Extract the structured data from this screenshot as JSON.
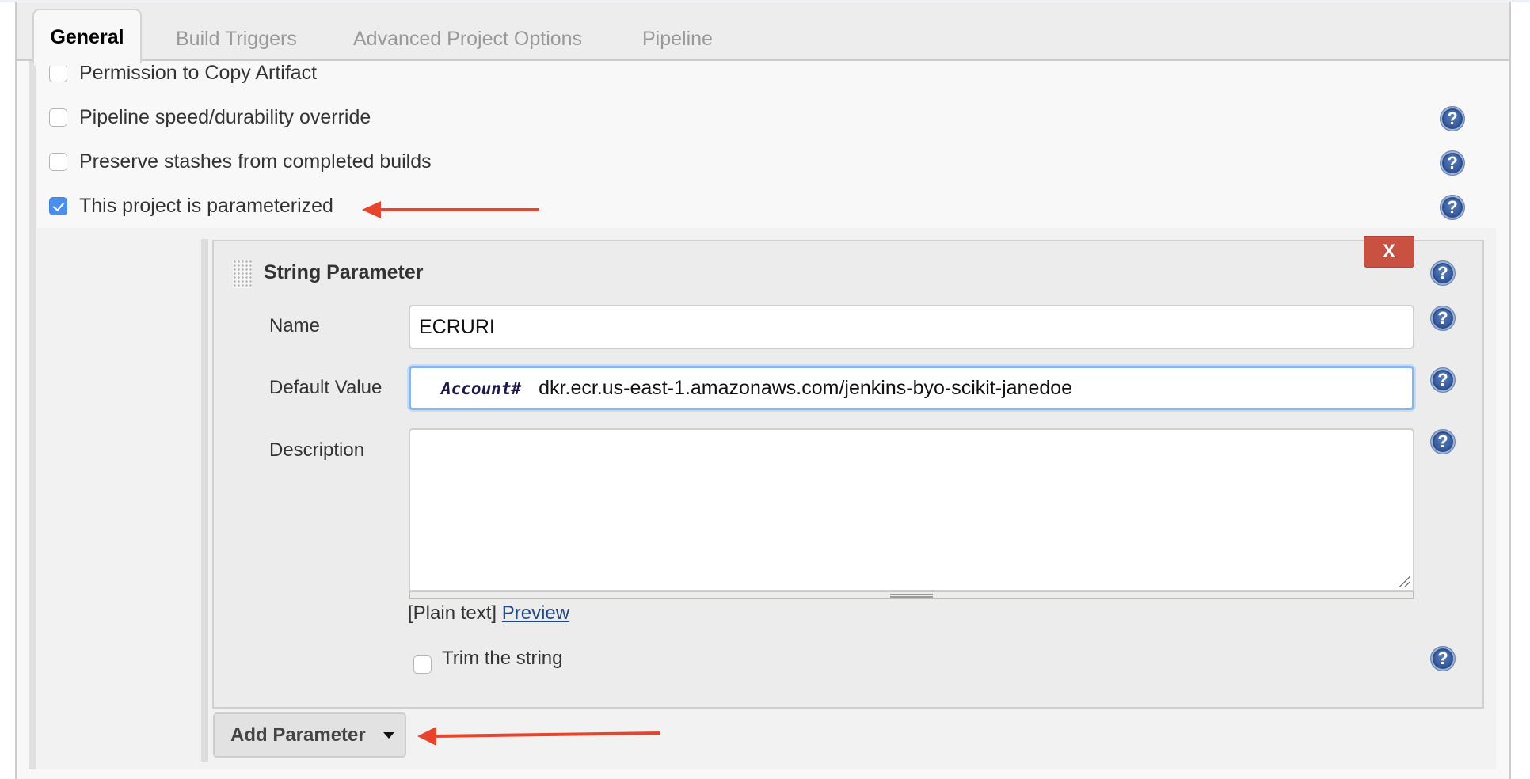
{
  "tabs": [
    {
      "label": "General",
      "active": true
    },
    {
      "label": "Build Triggers",
      "active": false
    },
    {
      "label": "Advanced Project Options",
      "active": false
    },
    {
      "label": "Pipeline",
      "active": false
    }
  ],
  "options": [
    {
      "label": "Permission to Copy Artifact",
      "checked": false,
      "has_help": false
    },
    {
      "label": "Pipeline speed/durability override",
      "checked": false,
      "has_help": true
    },
    {
      "label": "Preserve stashes from completed builds",
      "checked": false,
      "has_help": true
    },
    {
      "label": "This project is parameterized",
      "checked": true,
      "has_help": true
    }
  ],
  "help_icon_glyph": "?",
  "parameter": {
    "title": "String Parameter",
    "delete_label": "X",
    "name_label": "Name",
    "name_value": "ECRURI",
    "default_label": "Default Value",
    "default_redaction_tag": "Account#",
    "default_value": "dkr.ecr.us-east-1.amazonaws.com/jenkins-byo-scikit-janedoe",
    "description_label": "Description",
    "description_value": "",
    "markup_prefix": "[Plain text]",
    "preview_link": "Preview",
    "trim_label": "Trim the string",
    "trim_checked": false
  },
  "add_parameter_label": "Add Parameter",
  "annotation_color": "#e8432c",
  "colors": {
    "checkbox_checked": "#4a8ff0",
    "delete_button": "#c85142",
    "focus_ring": "#8ab4ea",
    "link": "#204a87"
  }
}
